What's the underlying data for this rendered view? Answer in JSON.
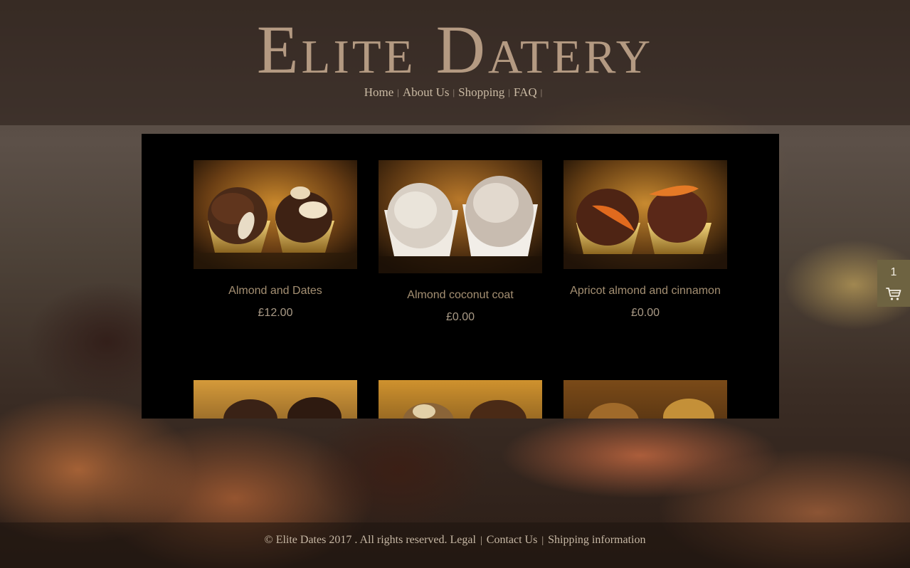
{
  "site": {
    "logo_text": "Elite Datery"
  },
  "nav": {
    "items": [
      {
        "label": "Home"
      },
      {
        "label": "About Us"
      },
      {
        "label": "Shopping"
      },
      {
        "label": "FAQ"
      }
    ],
    "separator": "|"
  },
  "products": [
    {
      "name": "Almond and Dates",
      "price": "£12.00",
      "photo": "almond-date-truffles"
    },
    {
      "name": "Almond coconut coat",
      "price": "£0.00",
      "photo": "coconut-date-truffles"
    },
    {
      "name": "Apricot almond and cinnamon",
      "price": "£0.00",
      "photo": "apricot-date-truffles"
    },
    {
      "name": "",
      "price": "",
      "photo": "chocolate-sprinkle-truffles"
    },
    {
      "name": "",
      "price": "",
      "photo": "nut-date-truffles"
    },
    {
      "name": "",
      "price": "",
      "photo": "hazelnut-date-truffles"
    }
  ],
  "cart": {
    "count": "1",
    "icon": "shopping-cart-icon"
  },
  "footer": {
    "copyright": "© Elite Dates 2017 . All rights reserved.",
    "links": [
      {
        "label": "Legal"
      },
      {
        "label": "Contact Us"
      },
      {
        "label": "Shipping information"
      }
    ],
    "separator": "|"
  },
  "colors": {
    "panel": "#000000",
    "product_name": "#a48f72",
    "cart_badge": "#6e6341",
    "logo": "#b49a82"
  }
}
